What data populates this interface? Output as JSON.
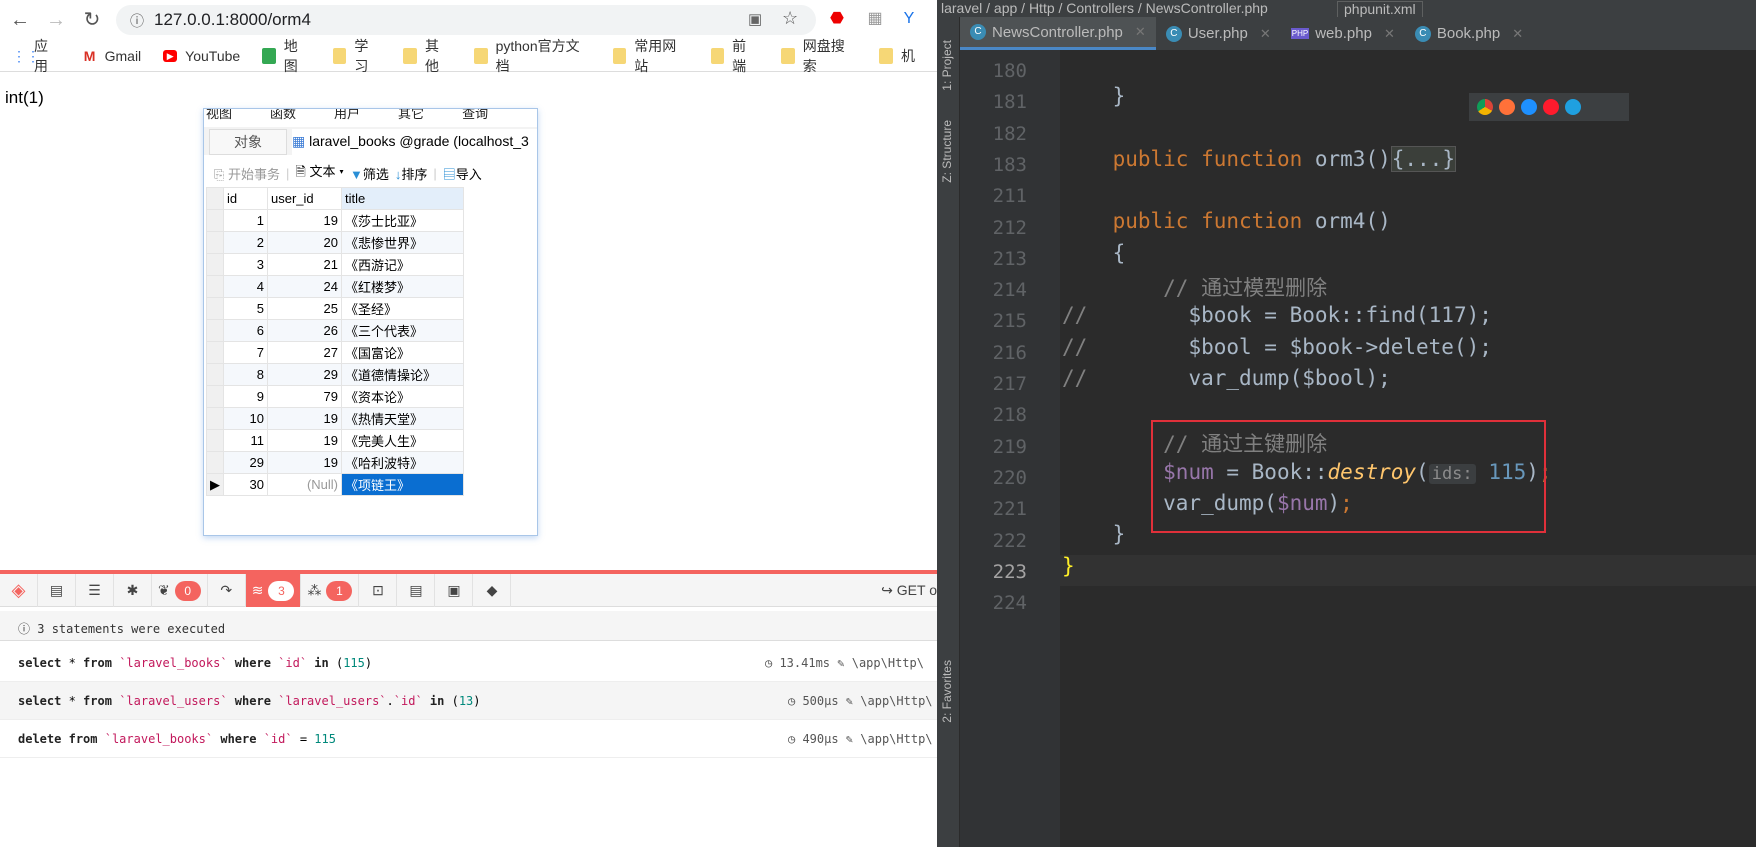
{
  "browser": {
    "url": "127.0.0.1:8000/orm4",
    "bookmarks": [
      {
        "label": "应用",
        "icon": "apps-icon"
      },
      {
        "label": "Gmail",
        "icon": "gmail-icon"
      },
      {
        "label": "YouTube",
        "icon": "youtube-icon"
      },
      {
        "label": "地图",
        "icon": "maps-icon"
      },
      {
        "label": "学习",
        "icon": "folder-icon"
      },
      {
        "label": "其他",
        "icon": "folder-icon"
      },
      {
        "label": "python官方文档",
        "icon": "folder-icon"
      },
      {
        "label": "常用网站",
        "icon": "folder-icon"
      },
      {
        "label": "前端",
        "icon": "folder-icon"
      },
      {
        "label": "网盘搜索",
        "icon": "folder-icon"
      },
      {
        "label": "机",
        "icon": "folder-icon"
      }
    ],
    "output": "int(1)"
  },
  "navicat": {
    "menu": [
      "视图",
      "函数",
      "用户",
      "其它",
      "查询"
    ],
    "objects_tab": "对象",
    "table_tab": "laravel_books @grade (localhost_3",
    "toolbar": {
      "begin": "开始事务",
      "text": "文本",
      "filter": "筛选",
      "sort": "排序",
      "import": "导入"
    },
    "columns": [
      "id",
      "user_id",
      "title"
    ],
    "rows": [
      [
        "1",
        "19",
        "《莎士比亚》"
      ],
      [
        "2",
        "20",
        "《悲惨世界》"
      ],
      [
        "3",
        "21",
        "《西游记》"
      ],
      [
        "4",
        "24",
        "《红楼梦》"
      ],
      [
        "5",
        "25",
        "《圣经》"
      ],
      [
        "6",
        "26",
        "《三个代表》"
      ],
      [
        "7",
        "27",
        "《国富论》"
      ],
      [
        "8",
        "29",
        "《道德情操论》"
      ],
      [
        "9",
        "79",
        "《资本论》"
      ],
      [
        "10",
        "19",
        "《热情天堂》"
      ],
      [
        "11",
        "19",
        "《完美人生》"
      ],
      [
        "29",
        "19",
        "《哈利波特》"
      ],
      [
        "30",
        "(Null)",
        "《项链王》"
      ]
    ]
  },
  "debugbar": {
    "badges": {
      "messages": "0",
      "queries": "3",
      "models": "1"
    },
    "request": "GET o",
    "info": "3 statements were executed",
    "queries": [
      {
        "time": "13.41ms",
        "path": "\\app\\Http\\"
      },
      {
        "time": "500μs",
        "path": "\\app\\Http\\"
      },
      {
        "time": "490μs",
        "path": "\\app\\Http\\"
      }
    ]
  },
  "ide": {
    "breadcrumb": "laravel / app / Http / Controllers / NewsController.php",
    "run_config": "phpunit.xml",
    "tabs": [
      "NewsController.php",
      "User.php",
      "web.php",
      "Book.php"
    ],
    "side": [
      "1: Project",
      "Z: Structure",
      "2: Favorites"
    ],
    "line_numbers": [
      "180",
      "181",
      "182",
      "183",
      "211",
      "212",
      "213",
      "214",
      "215",
      "216",
      "217",
      "218",
      "219",
      "220",
      "221",
      "222",
      "223",
      "224"
    ],
    "accent": "#e0303a"
  }
}
